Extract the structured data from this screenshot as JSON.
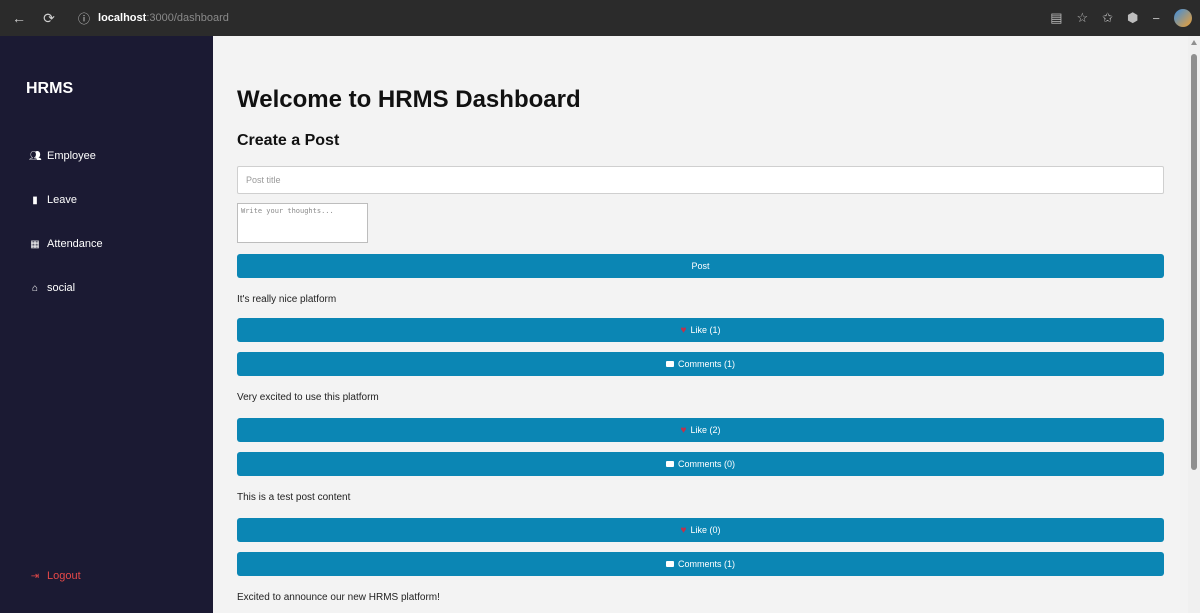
{
  "browser": {
    "url_host": "localhost",
    "url_path": ":3000/dashboard"
  },
  "sidebar": {
    "brand": "HRMS",
    "items": [
      {
        "label": "Employee",
        "icon": "users-icon"
      },
      {
        "label": "Leave",
        "icon": "clipboard-icon"
      },
      {
        "label": "Attendance",
        "icon": "calendar-icon"
      },
      {
        "label": "social",
        "icon": "home-icon"
      }
    ],
    "logout_label": "Logout"
  },
  "main": {
    "title": "Welcome to HRMS Dashboard",
    "create_post_title": "Create a Post",
    "title_placeholder": "Post title",
    "content_placeholder": "Write your thoughts...",
    "post_button": "Post",
    "posts": [
      {
        "text": "It's really nice platform",
        "likes": "Like (1)",
        "comments": "Comments (1)"
      },
      {
        "text": "Very excited to use this platform",
        "likes": "Like (2)",
        "comments": "Comments (0)"
      },
      {
        "text": "This is a test post content",
        "likes": "Like (0)",
        "comments": "Comments (1)"
      },
      {
        "text": "Excited to announce our new HRMS platform!"
      }
    ]
  },
  "colors": {
    "sidebar_bg": "#1b1a33",
    "button": "#0b86b4",
    "logout": "#e54848",
    "heart": "#c2304a"
  }
}
